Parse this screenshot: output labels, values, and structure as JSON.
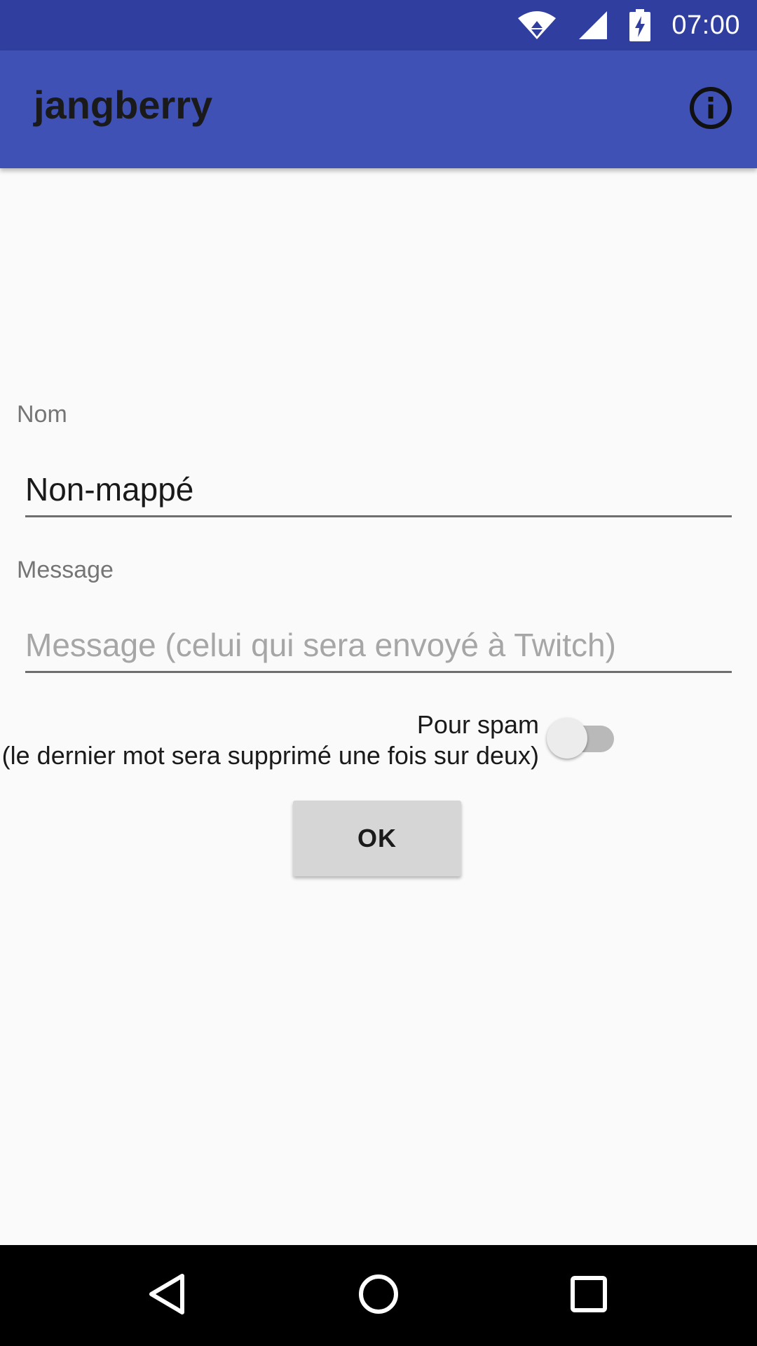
{
  "status_bar": {
    "time": "07:00",
    "icons": [
      "wifi-icon",
      "signal-icon",
      "battery-charging-icon"
    ],
    "background": "#303f9f"
  },
  "app_bar": {
    "title": "jangberry",
    "action_icon": "info-icon",
    "background": "#3f51b5"
  },
  "form": {
    "name_label": "Nom",
    "name_value": "Non-mappé",
    "message_label": "Message",
    "message_value": "",
    "message_placeholder": "Message (celui qui sera envoyé à Twitch)",
    "spam_label_line1": "Pour spam",
    "spam_label_line2": "(le dernier mot sera supprimé une fois sur deux)",
    "spam_enabled": false,
    "ok_label": "OK"
  },
  "nav_bar": {
    "icons": [
      "back-icon",
      "home-icon",
      "recents-icon"
    ]
  }
}
